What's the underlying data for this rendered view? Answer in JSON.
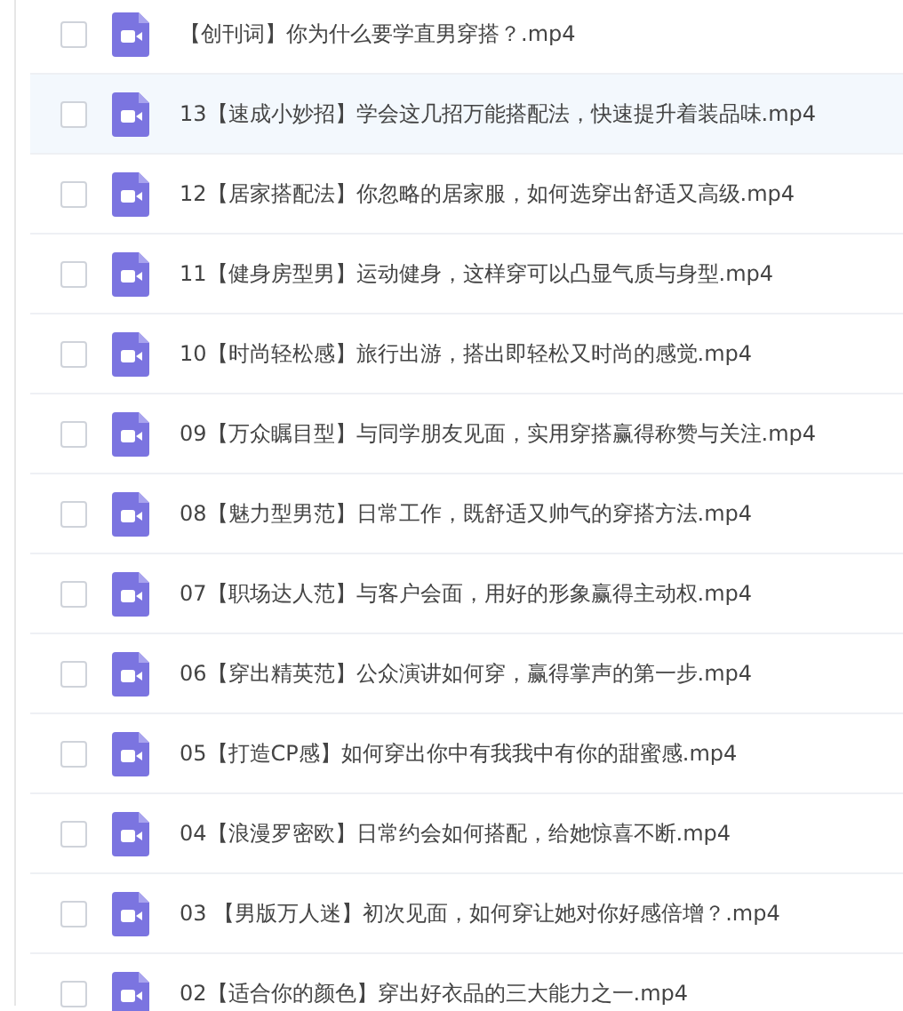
{
  "files": [
    {
      "name": "【创刊词】你为什么要学直男穿搭？.mp4",
      "checked": false,
      "highlighted": false
    },
    {
      "name": "13【速成小妙招】学会这几招万能搭配法，快速提升着装品味.mp4",
      "checked": false,
      "highlighted": true
    },
    {
      "name": "12【居家搭配法】你忽略的居家服，如何选穿出舒适又高级.mp4",
      "checked": false,
      "highlighted": false
    },
    {
      "name": "11【健身房型男】运动健身，这样穿可以凸显气质与身型.mp4",
      "checked": false,
      "highlighted": false
    },
    {
      "name": "10【时尚轻松感】旅行出游，搭出即轻松又时尚的感觉.mp4",
      "checked": false,
      "highlighted": false
    },
    {
      "name": "09【万众瞩目型】与同学朋友见面，实用穿搭赢得称赞与关注.mp4",
      "checked": false,
      "highlighted": false
    },
    {
      "name": "08【魅力型男范】日常工作，既舒适又帅气的穿搭方法.mp4",
      "checked": false,
      "highlighted": false
    },
    {
      "name": "07【职场达人范】与客户会面，用好的形象赢得主动权.mp4",
      "checked": false,
      "highlighted": false
    },
    {
      "name": "06【穿出精英范】公众演讲如何穿，赢得掌声的第一步.mp4",
      "checked": false,
      "highlighted": false
    },
    {
      "name": "05【打造CP感】如何穿出你中有我我中有你的甜蜜感.mp4",
      "checked": false,
      "highlighted": false
    },
    {
      "name": "04【浪漫罗密欧】日常约会如何搭配，给她惊喜不断.mp4",
      "checked": false,
      "highlighted": false
    },
    {
      "name": "03 【男版万人迷】初次见面，如何穿让她对你好感倍增？.mp4",
      "checked": false,
      "highlighted": false
    },
    {
      "name": "02【适合你的颜色】穿出好衣品的三大能力之一.mp4",
      "checked": false,
      "highlighted": false
    }
  ]
}
